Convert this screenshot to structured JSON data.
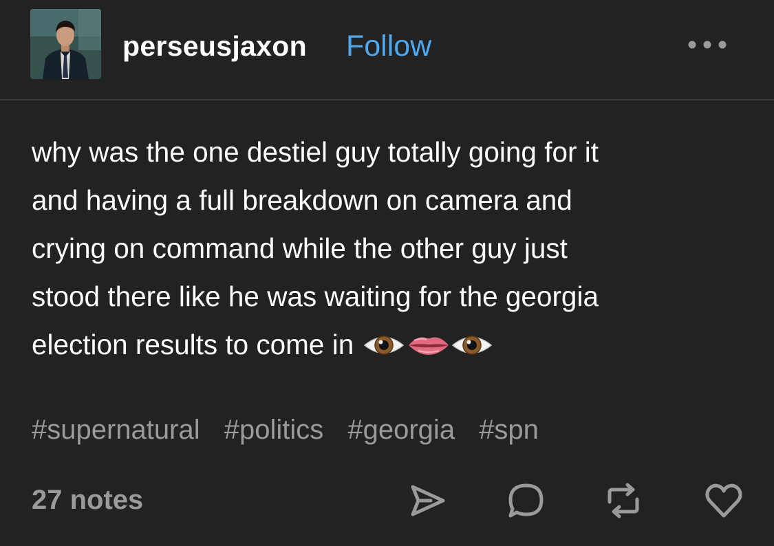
{
  "post": {
    "username": "perseusjaxon",
    "follow_label": "Follow",
    "more_icon": "more-horizontal-icon",
    "body_lines": [
      "why was the one destiel guy totally going for it",
      "and having a full breakdown on camera and",
      "crying on command while the other guy just",
      "stood there like he was waiting for the georgia",
      "election results to come in"
    ],
    "emoji": [
      "eye",
      "mouth",
      "eye"
    ],
    "tags": [
      "#supernatural",
      "#politics",
      "#georgia",
      "#spn"
    ],
    "notes_label": "27 notes",
    "actions": [
      "share-icon",
      "reply-icon",
      "reblog-icon",
      "like-icon"
    ]
  },
  "colors": {
    "background": "#222222",
    "text": "#ffffff",
    "accent": "#4fa8ee",
    "muted": "#9a9a9a",
    "divider": "#3a3a3a"
  }
}
